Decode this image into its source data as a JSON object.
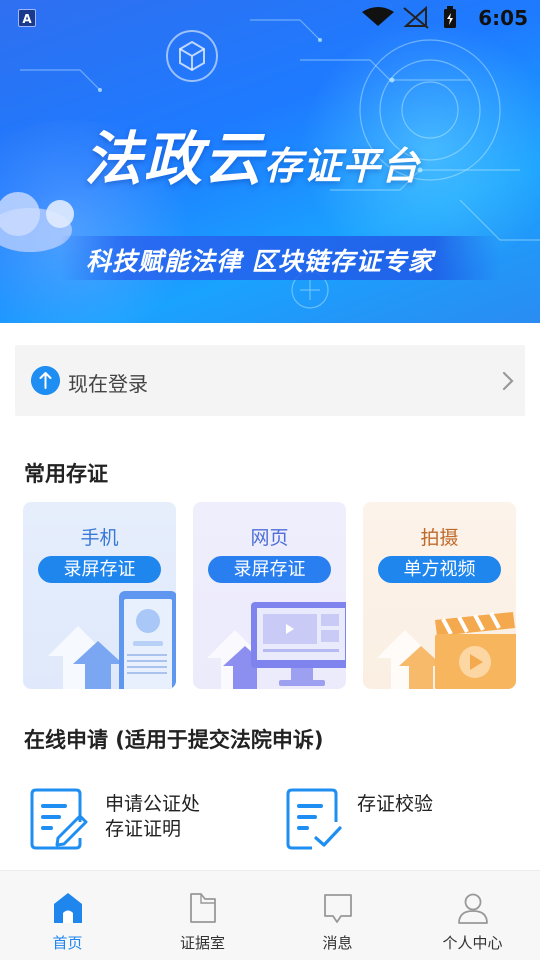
{
  "status_bar": {
    "app_badge": "A",
    "time": "6:05"
  },
  "banner": {
    "title_main": "法政云",
    "title_sub": "存证平台",
    "subtitle": "科技赋能法律 区块链存证专家"
  },
  "login": {
    "label": "现在登录"
  },
  "common_section": {
    "title": "常用存证",
    "cards": [
      {
        "title": "手机",
        "pill": "录屏存证"
      },
      {
        "title": "网页",
        "pill": "录屏存证"
      },
      {
        "title": "拍摄",
        "pill": "单方视频"
      }
    ]
  },
  "apply_section": {
    "title": "在线申请 (适用于提交法院申诉)",
    "items": [
      {
        "line1": "申请公证处",
        "line2": "存证证明"
      },
      {
        "line1": "存证校验",
        "line2": ""
      }
    ]
  },
  "bottom_nav": {
    "items": [
      {
        "label": "首页",
        "icon": "home-icon",
        "active": true
      },
      {
        "label": "证据室",
        "icon": "folder-icon",
        "active": false
      },
      {
        "label": "消息",
        "icon": "message-icon",
        "active": false
      },
      {
        "label": "个人中心",
        "icon": "user-icon",
        "active": false
      }
    ]
  },
  "colors": {
    "accent": "#1f86ee",
    "banner_start": "#2f6ff0",
    "banner_end": "#1aa2ff"
  }
}
